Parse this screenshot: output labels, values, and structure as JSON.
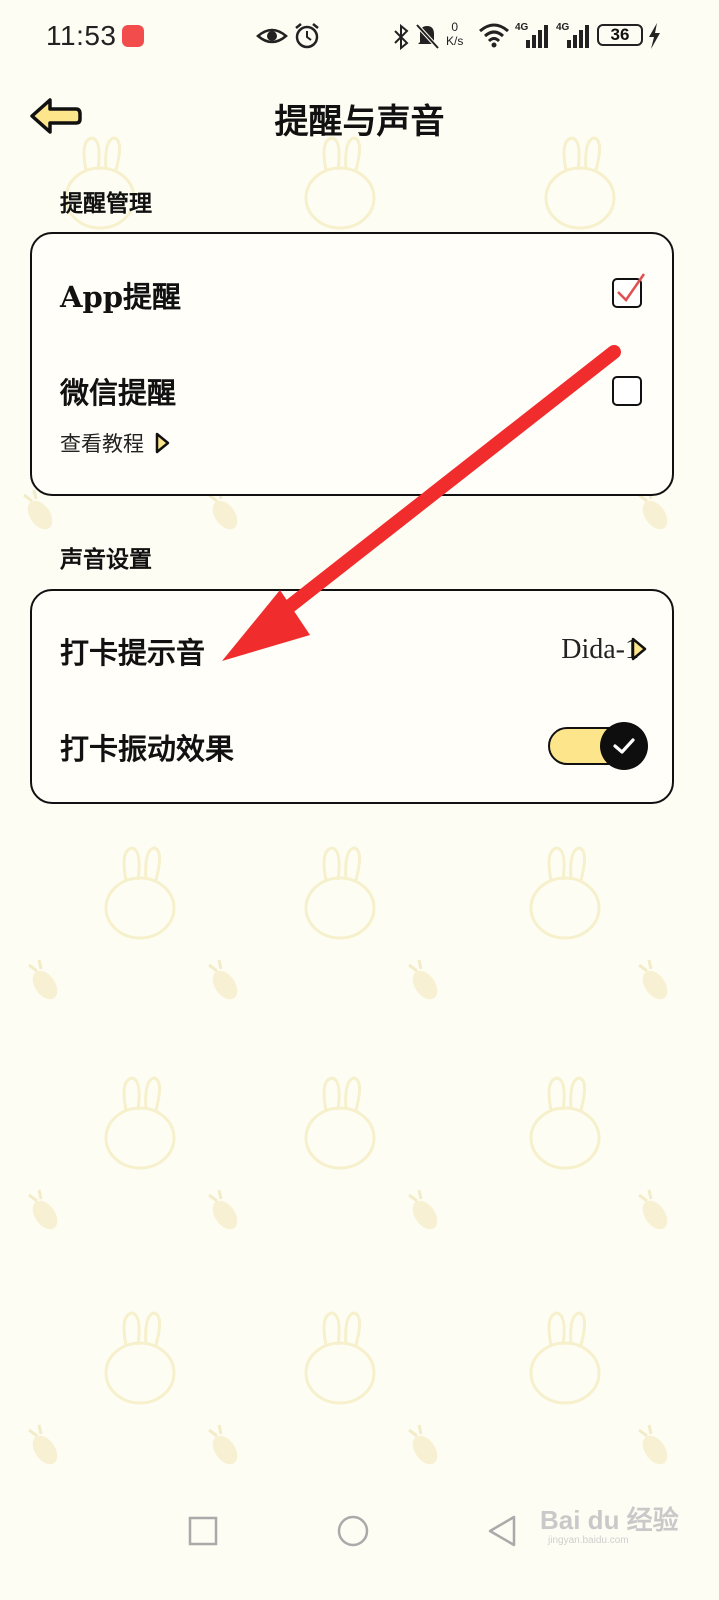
{
  "status_bar": {
    "time": "11:53",
    "net_speed_value": "0",
    "net_speed_unit": "K/s",
    "signal_1_label": "4G",
    "signal_2_label": "4G",
    "battery": "36",
    "icons": [
      "eye-icon",
      "alarm-icon",
      "bluetooth-icon",
      "mute-bell-icon",
      "wifi-icon",
      "signal-icon",
      "signal-icon",
      "battery-icon",
      "charging-icon"
    ]
  },
  "header": {
    "title": "提醒与声音",
    "back_icon": "back-arrow-icon"
  },
  "reminder_section": {
    "label": "提醒管理",
    "items": [
      {
        "label": "App提醒",
        "checked": true
      },
      {
        "label": "微信提醒",
        "checked": false
      }
    ],
    "tutorial_link": "查看教程"
  },
  "sound_section": {
    "label": "声音设置",
    "checkin_sound": {
      "label": "打卡提示音",
      "value": "Dida-1"
    },
    "vibration": {
      "label": "打卡振动效果",
      "enabled": true
    }
  },
  "watermark": {
    "text": "Bai du 经验",
    "sub": "jingyan.baidu.com"
  },
  "colors": {
    "background": "#fefdf3",
    "accent_yellow": "#fde58c",
    "annotation_red": "#f02c2c",
    "border": "#111111"
  }
}
